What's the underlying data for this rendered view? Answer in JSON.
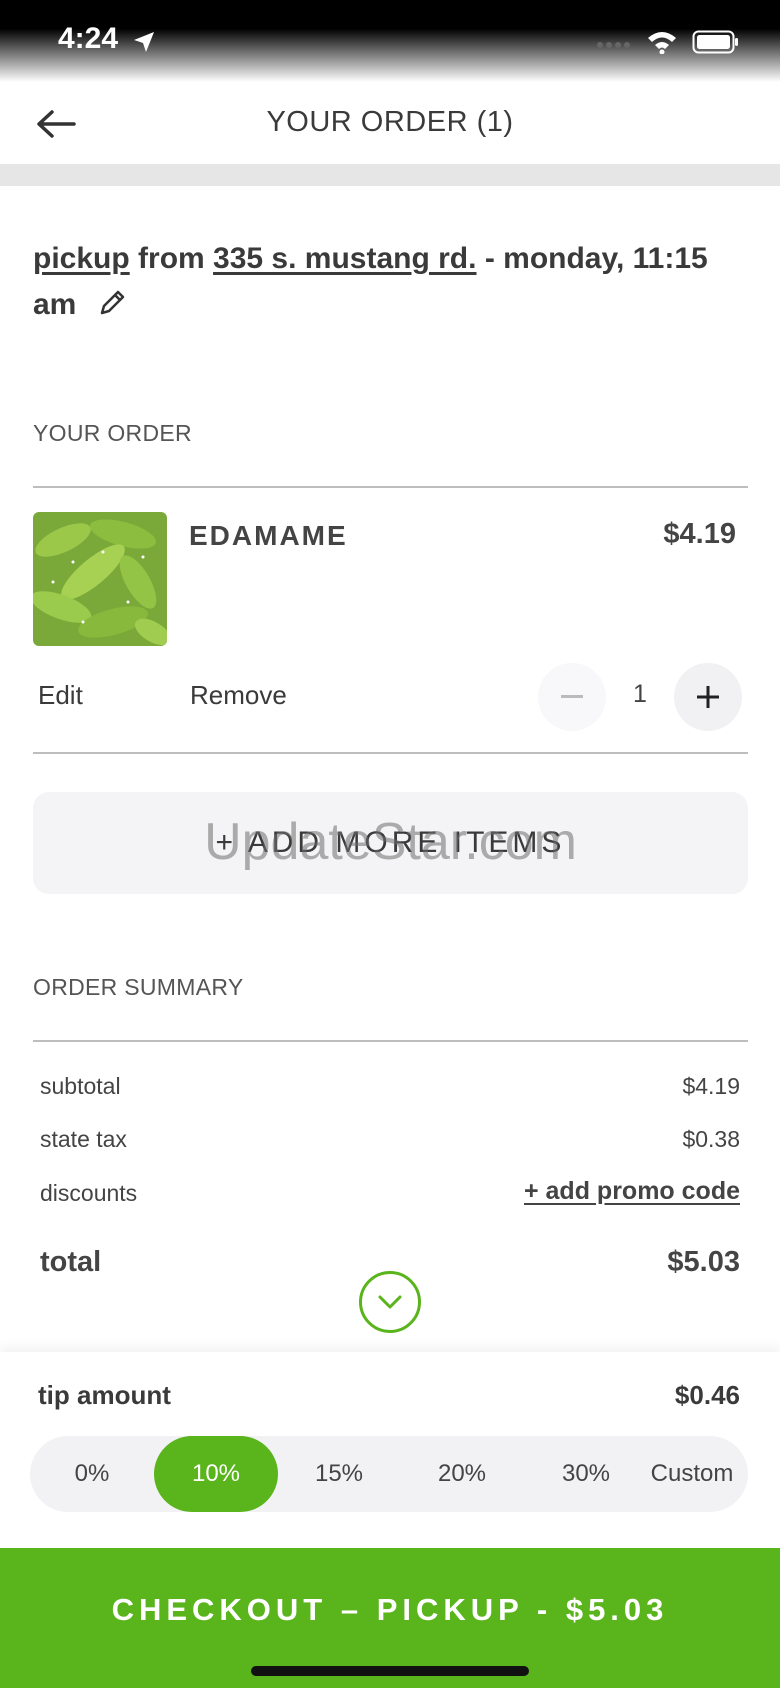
{
  "status_bar": {
    "time": "4:24"
  },
  "header": {
    "title": "YOUR ORDER (1)"
  },
  "pickup": {
    "mode": "pickup",
    "from_word": "from",
    "address": "335 s. mustang rd.",
    "when": "- monday, 11:15 am"
  },
  "order_section": {
    "label": "YOUR ORDER"
  },
  "items": [
    {
      "name": "EDAMAME",
      "price": "$4.19",
      "quantity": "1",
      "edit_label": "Edit",
      "remove_label": "Remove"
    }
  ],
  "add_more": {
    "label": "+ ADD MORE ITEMS",
    "watermark": "UpdateStar.com"
  },
  "summary": {
    "label": "ORDER SUMMARY",
    "subtotal_label": "subtotal",
    "subtotal": "$4.19",
    "tax_label": "state tax",
    "tax": "$0.38",
    "discounts_label": "discounts",
    "promo_label": "+ add promo code",
    "total_label": "total",
    "total": "$5.03"
  },
  "tip": {
    "label": "tip amount",
    "amount": "$0.46",
    "options": [
      "0%",
      "10%",
      "15%",
      "20%",
      "30%",
      "Custom"
    ],
    "selected": "10%"
  },
  "checkout": {
    "label": "CHECKOUT – PICKUP - $5.03"
  },
  "colors": {
    "accent": "#5ab41c"
  }
}
